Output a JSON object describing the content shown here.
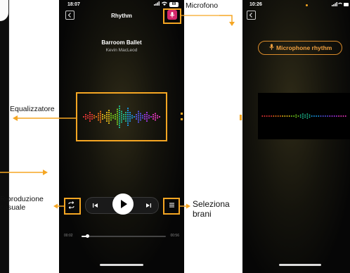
{
  "main_phone": {
    "status_time": "18:07",
    "status_battery": "69",
    "title": "Rhythm",
    "back_icon": "chevron-left-icon",
    "mic_icon": "microphone-icon",
    "song_title": "Barroom Ballet",
    "song_artist": "Kevin MacLeod",
    "time_elapsed": "00:02",
    "time_total": "00:56",
    "progress": 0.07,
    "accent_color": "#d4286b"
  },
  "annotations": {
    "microphone": "Microfono",
    "equalizer": "Equalizzatore",
    "shuffle_line1": "Riproduzione",
    "shuffle_line2": "casuale",
    "select_line1": "Seleziona",
    "select_line2": "brani",
    "color": "#f5a623"
  },
  "second_phone": {
    "status_time": "10:26",
    "mic_rhythm_label": "Microphone rhythm",
    "mic_icon": "microphone-icon"
  }
}
